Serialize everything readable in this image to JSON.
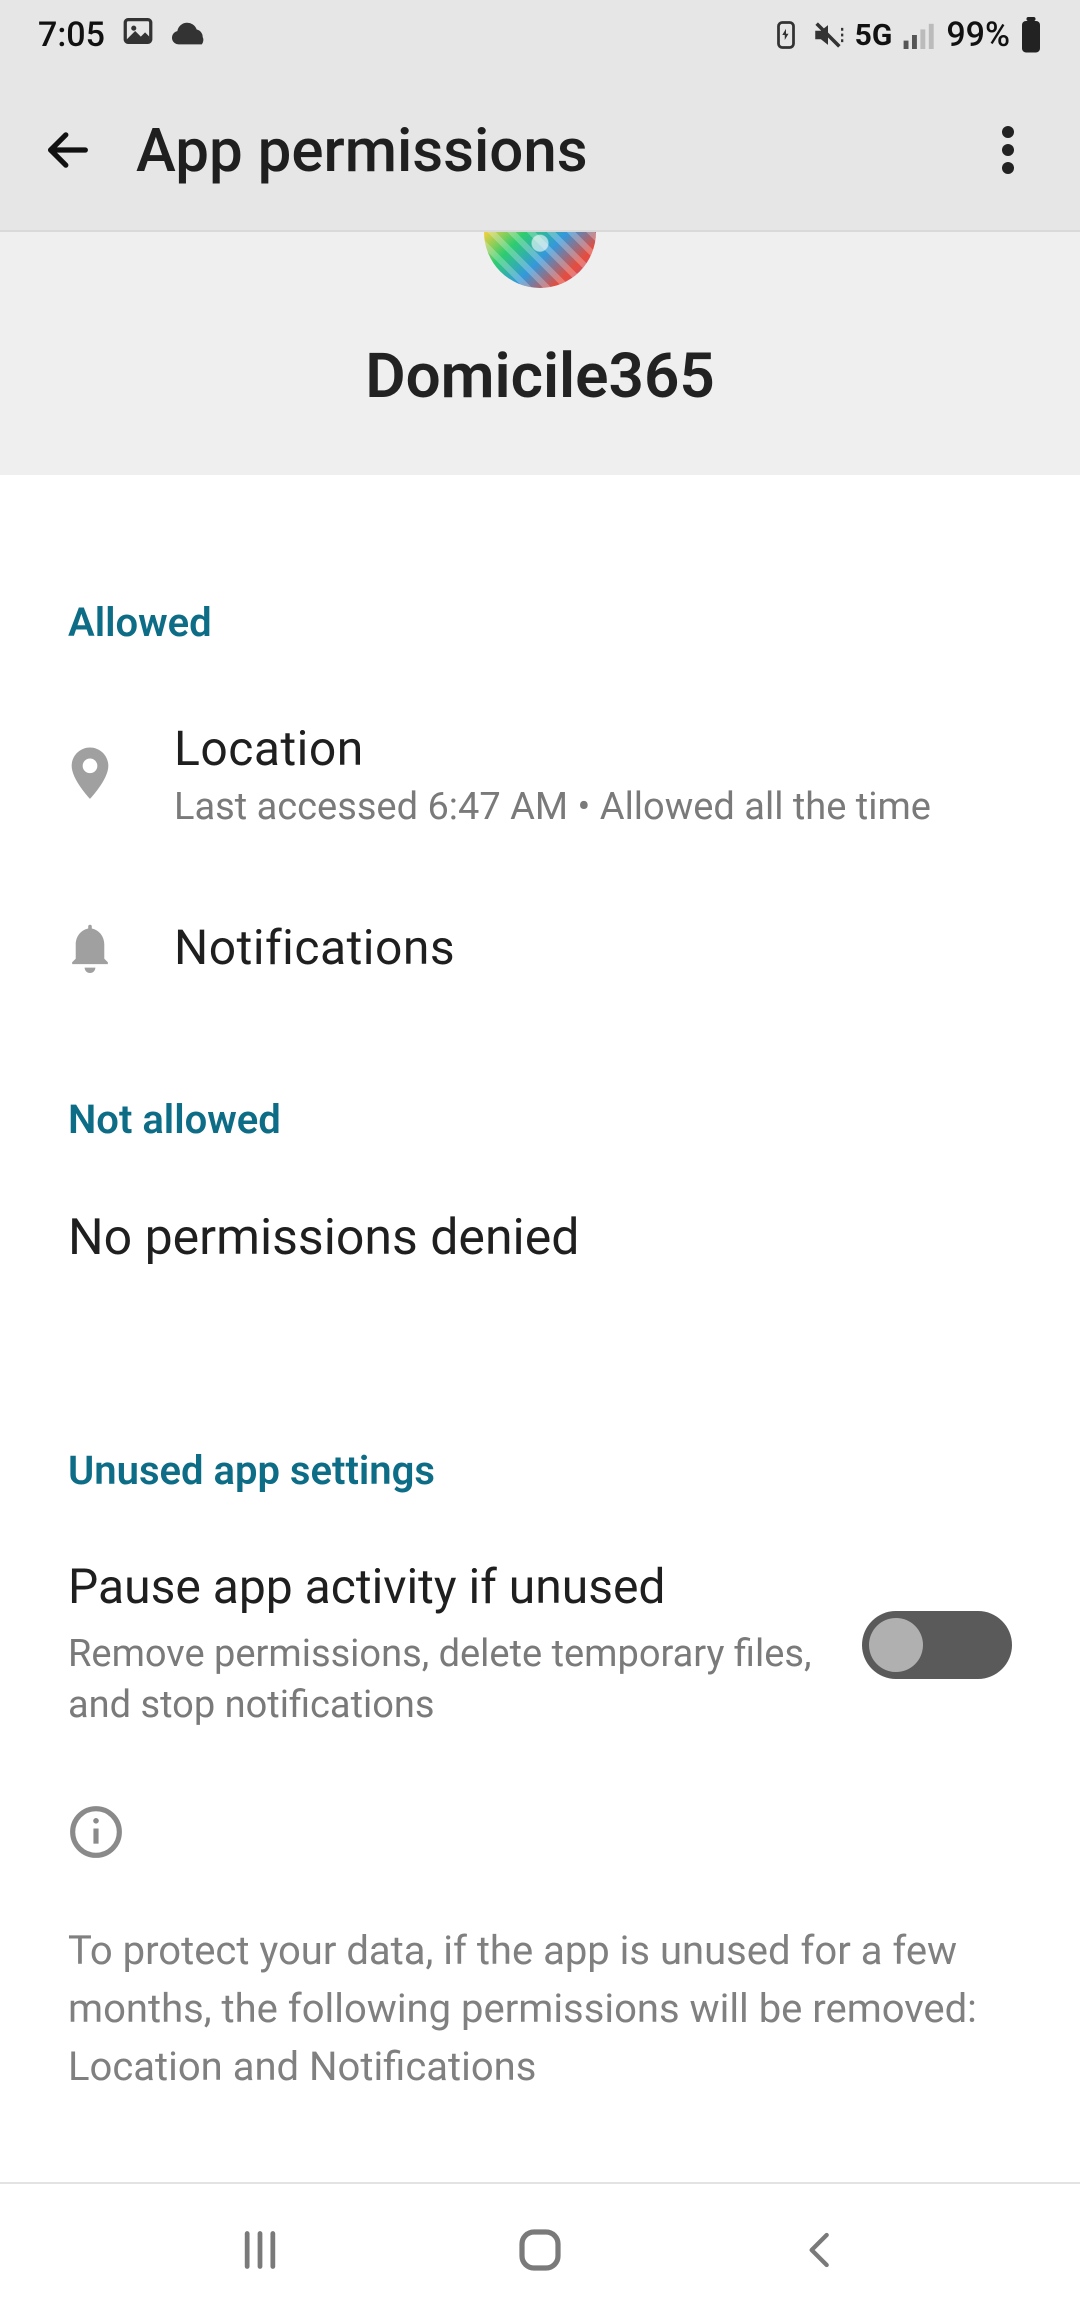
{
  "status_bar": {
    "time": "7:05",
    "network_label": "5G",
    "battery_percent": "99%"
  },
  "toolbar": {
    "title": "App permissions"
  },
  "app": {
    "name": "Domicile365"
  },
  "sections": {
    "allowed": {
      "header": "Allowed",
      "items": [
        {
          "title": "Location",
          "subtitle": "Last accessed 6:47 AM • Allowed all the time"
        },
        {
          "title": "Notifications",
          "subtitle": ""
        }
      ]
    },
    "not_allowed": {
      "header": "Not allowed",
      "body": "No permissions denied"
    },
    "unused": {
      "header": "Unused app settings",
      "toggle": {
        "title": "Pause app activity if unused",
        "subtitle": "Remove permissions, delete temporary files, and stop notifications",
        "on": false
      },
      "info_text": "To protect your data, if the app is unused for a few months, the following permissions will be removed: Location and Notifications"
    }
  }
}
